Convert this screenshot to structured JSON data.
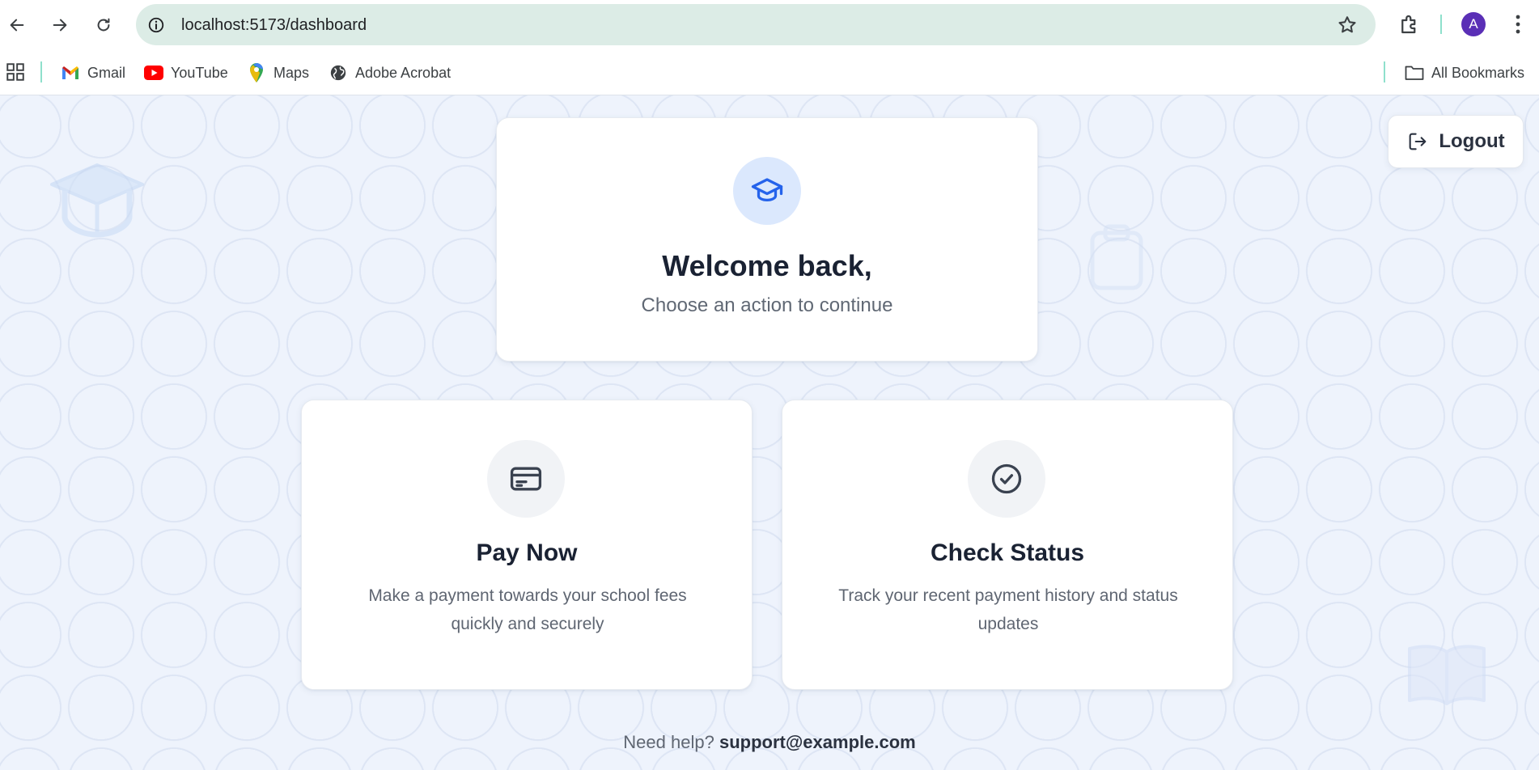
{
  "browser": {
    "url": "localhost:5173/dashboard",
    "avatar_letter": "A",
    "bookmarks": [
      {
        "label": "Gmail",
        "icon": "gmail-icon"
      },
      {
        "label": "YouTube",
        "icon": "youtube-icon"
      },
      {
        "label": "Maps",
        "icon": "maps-icon"
      },
      {
        "label": "Adobe Acrobat",
        "icon": "globe-icon"
      }
    ],
    "all_bookmarks_label": "All Bookmarks"
  },
  "header": {
    "logout_label": "Logout"
  },
  "welcome": {
    "title": "Welcome back,",
    "subtitle": "Choose an action to continue",
    "icon": "graduation-cap-icon"
  },
  "actions": [
    {
      "title": "Pay Now",
      "description": "Make a payment towards your school fees quickly and securely",
      "icon": "credit-card-icon"
    },
    {
      "title": "Check Status",
      "description": "Track your recent payment history and status updates",
      "icon": "check-circle-icon"
    }
  ],
  "footer": {
    "help_text": "Need help?",
    "email": "support@example.com"
  },
  "colors": {
    "accent": "#2563eb",
    "accent_soft": "#dbe8fd",
    "page_background": "#eef3fc",
    "title_text": "#1a2233"
  }
}
